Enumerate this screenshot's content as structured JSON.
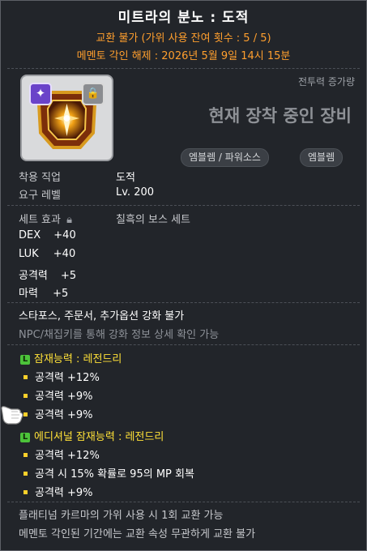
{
  "tooltip": {
    "title": "미트라의 분노 : 도적",
    "trade_info": "교환 불가 (가위 사용 잔여 횟수 : 5 / 5)",
    "memento": "메멘토 각인 해제 : 2026년 5월 9일 14시 15분",
    "cp_label": "전투력 증가량",
    "equip_label": "현재 장착 중인 장비",
    "tags": [
      "엠블렘 / 파워소스",
      "엠블렘"
    ],
    "req_job_label": "착용 직업",
    "req_job_value": "도적",
    "req_level_label": "요구 레벨",
    "req_level_value": "Lv. 200",
    "set_label": "세트 효과",
    "set_value": "칠흑의 보스 세트",
    "stats": [
      {
        "name": "DEX",
        "value": "+40"
      },
      {
        "name": "LUK",
        "value": "+40"
      },
      {
        "name": "공격력",
        "value": "+5"
      },
      {
        "name": "마력",
        "value": "+5"
      }
    ],
    "no_enhance": "스타포스, 주문서, 추가옵션 강화 불가",
    "npc_note": "NPC/채집키를 통해 강화 정보 상세 확인 가능",
    "potential": {
      "badge": "L",
      "header": "잠재능력 : 레전드리",
      "lines": [
        "공격력 +12%",
        "공격력 +9%",
        "공격력 +9%"
      ]
    },
    "additional": {
      "badge": "L",
      "header": "에디셔널 잠재능력 : 레전드리",
      "lines": [
        "공격력 +12%",
        "공격 시 15% 확률로 95의 MP 회복",
        "공격력 +9%"
      ]
    },
    "footer": [
      "플래티넘 카르마의 가위 사용 시 1회 교환 가능",
      "메멘토 각인된 기간에는 교환 속성 무관하게 교환 불가"
    ]
  }
}
